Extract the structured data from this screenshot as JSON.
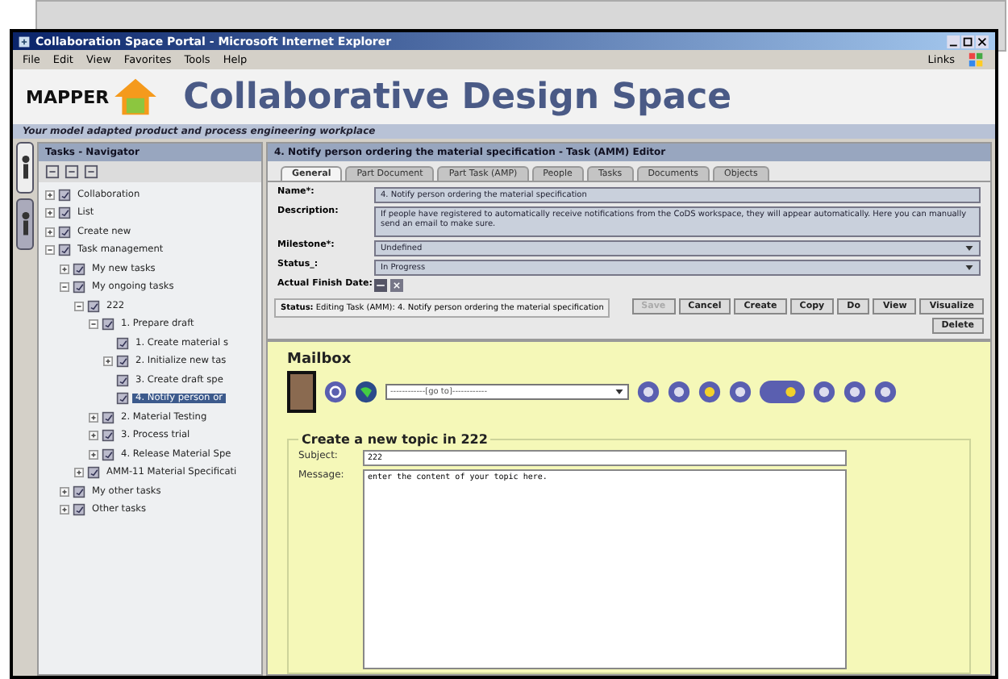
{
  "window": {
    "title": "Collaboration Space Portal - Microsoft Internet Explorer"
  },
  "menu": [
    "File",
    "Edit",
    "View",
    "Favorites",
    "Tools",
    "Help"
  ],
  "links": "Links",
  "header": {
    "logo": "MAPPER",
    "title": "Collaborative Design Space",
    "subtitle": "Your model adapted product and process engineering workplace"
  },
  "navigator": {
    "title": "Tasks - Navigator",
    "tree": [
      {
        "label": "Collaboration",
        "expanded": false,
        "selected": false
      },
      {
        "label": "List",
        "expanded": false,
        "selected": false
      },
      {
        "label": "Create new",
        "expanded": false,
        "selected": false
      },
      {
        "label": "Task management",
        "expanded": true,
        "selected": false,
        "children": [
          {
            "label": "My new tasks",
            "expanded": false,
            "selected": false
          },
          {
            "label": "My ongoing tasks",
            "expanded": true,
            "selected": false,
            "children": [
              {
                "label": "222",
                "expanded": true,
                "selected": false,
                "children": [
                  {
                    "label": "1. Prepare draft",
                    "expanded": true,
                    "selected": false,
                    "children": [
                      {
                        "label": "1. Create material s",
                        "selected": false
                      },
                      {
                        "label": "2. Initialize new tas",
                        "expanded": false,
                        "selected": false
                      },
                      {
                        "label": "3. Create draft spe",
                        "selected": false
                      },
                      {
                        "label": "4. Notify person or",
                        "selected": true
                      }
                    ]
                  },
                  {
                    "label": "2. Material Testing",
                    "expanded": false,
                    "selected": false
                  },
                  {
                    "label": "3. Process trial",
                    "expanded": false,
                    "selected": false
                  },
                  {
                    "label": "4. Release Material Spe",
                    "expanded": false,
                    "selected": false
                  }
                ]
              },
              {
                "label": "AMM-11 Material Specificati",
                "expanded": false,
                "selected": false
              }
            ]
          },
          {
            "label": "My other tasks",
            "expanded": false,
            "selected": false
          },
          {
            "label": "Other tasks",
            "expanded": false,
            "selected": false
          }
        ]
      }
    ]
  },
  "editor": {
    "title": "4. Notify person ordering the material specification - Task (AMM) Editor",
    "tabs": [
      {
        "label": "General",
        "selected": true
      },
      {
        "label": "Part Document",
        "selected": false
      },
      {
        "label": "Part Task (AMP)",
        "selected": false
      },
      {
        "label": "People",
        "selected": false
      },
      {
        "label": "Tasks",
        "selected": false
      },
      {
        "label": "Documents",
        "selected": false
      },
      {
        "label": "Objects",
        "selected": false
      }
    ],
    "fields": [
      {
        "kind": "text",
        "label": "Name*:",
        "value": "4. Notify person ordering the material specification"
      },
      {
        "kind": "textarea",
        "label": "Description:",
        "value": "If people have registered to automatically receive notifications from the CoDS workspace, they will appear automatically. Here you can manually send an email to make sure."
      },
      {
        "kind": "select",
        "label": "Milestone*:",
        "value": "Undefined"
      },
      {
        "kind": "select",
        "label": "Status_:",
        "value": "In Progress"
      },
      {
        "kind": "date",
        "label": "Actual Finish Date:"
      }
    ],
    "status_label": "Status:",
    "status": "Editing Task (AMM): 4. Notify person ordering the material specification",
    "buttons": [
      {
        "label": "Save",
        "disabled": true
      },
      {
        "label": "Cancel",
        "disabled": false
      },
      {
        "label": "Create",
        "disabled": false
      },
      {
        "label": "Copy",
        "disabled": false
      },
      {
        "label": "Do",
        "disabled": false
      },
      {
        "label": "View",
        "disabled": false
      },
      {
        "label": "Visualize",
        "disabled": false
      },
      {
        "label": "Delete",
        "disabled": false
      }
    ]
  },
  "mailbox": {
    "title": "Mailbox",
    "goto": "------------[go to]------------",
    "topic": {
      "legend": "Create a new topic in 222",
      "subject_label": "Subject:",
      "subject": "222",
      "message_label": "Message:",
      "message": "enter the content of your topic here."
    }
  }
}
